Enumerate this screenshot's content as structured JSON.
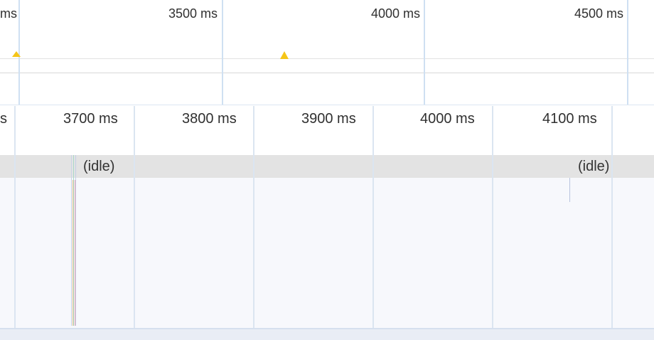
{
  "overview": {
    "ticks": [
      {
        "label": "ms"
      },
      {
        "label": "3500 ms"
      },
      {
        "label": "4000 ms"
      },
      {
        "label": "4500 ms"
      }
    ],
    "spike_color": "#f5c518"
  },
  "timeline": {
    "ticks": [
      {
        "label": "s"
      },
      {
        "label": "3700 ms"
      },
      {
        "label": "3800 ms"
      },
      {
        "label": "3900 ms"
      },
      {
        "label": "4000 ms"
      },
      {
        "label": "4100 ms"
      }
    ],
    "idle_labels": [
      "(idle)",
      "(idle)"
    ],
    "colors": {
      "idle_row": "#e3e3e3",
      "flame_bg": "#f7f8fc",
      "grid_line": "#dbe5f1"
    }
  }
}
